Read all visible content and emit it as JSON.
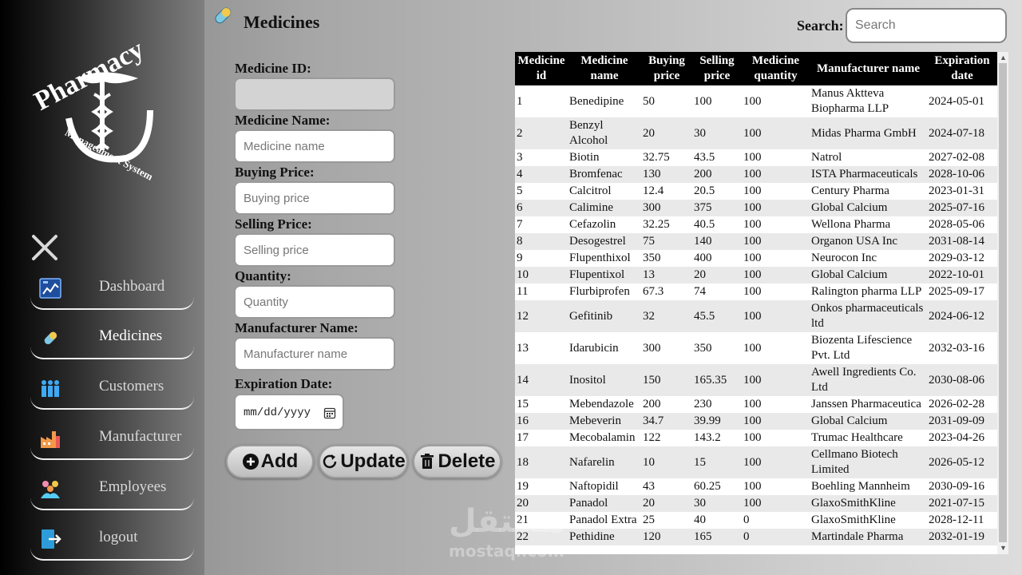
{
  "sidebar": {
    "logo_text": "Pharmacy Manageament System",
    "items": [
      {
        "label": "Dashboard",
        "icon": "dashboard-icon"
      },
      {
        "label": "Medicines",
        "icon": "pill-icon"
      },
      {
        "label": "Customers",
        "icon": "customers-icon"
      },
      {
        "label": "Manufacturer",
        "icon": "factory-icon"
      },
      {
        "label": "Employees",
        "icon": "employees-icon"
      },
      {
        "label": "logout",
        "icon": "logout-icon"
      }
    ]
  },
  "header": {
    "title": "Medicines",
    "search_label": "Search:",
    "search_placeholder": "Search"
  },
  "form": {
    "id_label": "Medicine ID:",
    "name_label": "Medicine Name:",
    "name_placeholder": "Medicine name",
    "buying_label": "Buying Price:",
    "buying_placeholder": "Buying price",
    "selling_label": "Selling Price:",
    "selling_placeholder": "Selling price",
    "quantity_label": "Quantity:",
    "quantity_placeholder": "Quantity",
    "manufacturer_label": "Manufacturer Name:",
    "manufacturer_placeholder": "Manufacturer name",
    "expiration_label": "Expiration Date:",
    "expiration_value": "mm/dd/yyyy"
  },
  "buttons": {
    "add": "Add",
    "update": "Update",
    "delete": "Delete"
  },
  "table": {
    "headers": [
      "Medicine id",
      "Medicine name",
      "Buying price",
      "Selling price",
      "Medicine quantity",
      "Manufacturer name",
      "Expiration date"
    ],
    "rows": [
      [
        "1",
        "Benedipine",
        "50",
        "100",
        "100",
        "Manus Aktteva Biopharma LLP",
        "2024-05-01"
      ],
      [
        "2",
        "Benzyl Alcohol",
        "20",
        "30",
        "100",
        "Midas Pharma GmbH",
        "2024-07-18"
      ],
      [
        "3",
        "Biotin",
        "32.75",
        "43.5",
        "100",
        "Natrol",
        "2027-02-08"
      ],
      [
        "4",
        "Bromfenac",
        "130",
        "200",
        "100",
        "ISTA Pharmaceuticals",
        "2028-10-06"
      ],
      [
        "5",
        "Calcitrol",
        "12.4",
        "20.5",
        "100",
        "Century Pharma",
        "2023-01-31"
      ],
      [
        "6",
        "Calimine",
        "300",
        "375",
        "100",
        "Global Calcium",
        "2025-07-16"
      ],
      [
        "7",
        "Cefazolin",
        "32.25",
        "40.5",
        "100",
        "Wellona Pharma",
        "2028-05-06"
      ],
      [
        "8",
        "Desogestrel",
        "75",
        "140",
        "100",
        "Organon USA Inc",
        "2031-08-14"
      ],
      [
        "9",
        "Flupenthixol",
        "350",
        "400",
        "100",
        "Neurocon Inc",
        "2029-03-12"
      ],
      [
        "10",
        "Flupentixol",
        "13",
        "20",
        "100",
        "Global Calcium",
        "2022-10-01"
      ],
      [
        "11",
        "Flurbiprofen",
        "67.3",
        "74",
        "100",
        "Ralington pharma LLP",
        "2025-09-17"
      ],
      [
        "12",
        "Gefitinib",
        "32",
        "45.5",
        "100",
        "Onkos pharmaceuticals ltd",
        "2024-06-12"
      ],
      [
        "13",
        "Idarubicin",
        "300",
        "350",
        "100",
        "Biozenta Lifescience Pvt. Ltd",
        "2032-03-16"
      ],
      [
        "14",
        "Inositol",
        "150",
        "165.35",
        "100",
        "Awell Ingredients Co. Ltd",
        "2030-08-06"
      ],
      [
        "15",
        "Mebendazole",
        "200",
        "230",
        "100",
        "Janssen Pharmaceutica",
        "2026-02-28"
      ],
      [
        "16",
        "Mebeverin",
        "34.7",
        "39.99",
        "100",
        "Global Calcium",
        "2031-09-09"
      ],
      [
        "17",
        "Mecobalamin",
        "122",
        "143.2",
        "100",
        "Trumac Healthcare",
        "2023-04-26"
      ],
      [
        "18",
        "Nafarelin",
        "10",
        "15",
        "100",
        "Cellmano Biotech Limited",
        "2026-05-12"
      ],
      [
        "19",
        "Naftopidil",
        "43",
        "60.25",
        "100",
        "Boehling Mannheim",
        "2030-09-16"
      ],
      [
        "20",
        "Panadol",
        "20",
        "30",
        "100",
        "GlaxoSmithKline",
        "2021-07-15"
      ],
      [
        "21",
        "Panadol Extra",
        "25",
        "40",
        "0",
        "GlaxoSmithKline",
        "2028-12-11"
      ],
      [
        "22",
        "Pethidine",
        "120",
        "165",
        "0",
        "Martindale Pharma",
        "2032-01-19"
      ]
    ]
  },
  "watermark": {
    "arabic": "مستقل",
    "latin": "mostaql.com"
  },
  "colors": {
    "header_bg": "#000000",
    "row_alt": "#e9e9e9"
  }
}
